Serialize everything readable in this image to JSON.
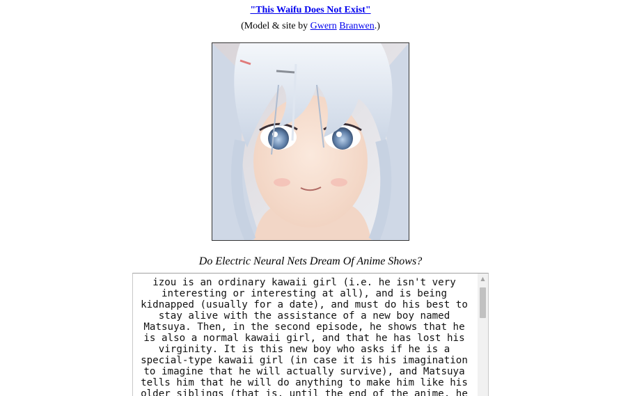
{
  "header": {
    "title": "\"This Waifu Does Not Exist\"",
    "credit_prefix": "(Model & site by ",
    "credit_link_1": "Gwern",
    "credit_link_2": "Branwen",
    "credit_suffix": ".)"
  },
  "image": {
    "icon": "anime-portrait-image"
  },
  "story": {
    "heading": "Do Electric Neural Nets Dream Of Anime Shows?",
    "text": "izou is an ordinary kawaii girl (i.e. he isn't very interesting or interesting at all), and is being kidnapped (usually for a date), and must do his best to stay alive with the assistance of a new boy named Matsuya. Then, in the second episode, he shows that he is also a normal kawaii girl, and that he has lost his virginity. It is this new boy who asks if he is a special-type kawaii girl (in case it is his imagination to imagine that he will actually survive), and Matsuya tells him that he will do anything to make him like his older siblings (that is, until the end of the anime, he"
  },
  "scrollbar": {
    "up_arrow": "▲"
  }
}
